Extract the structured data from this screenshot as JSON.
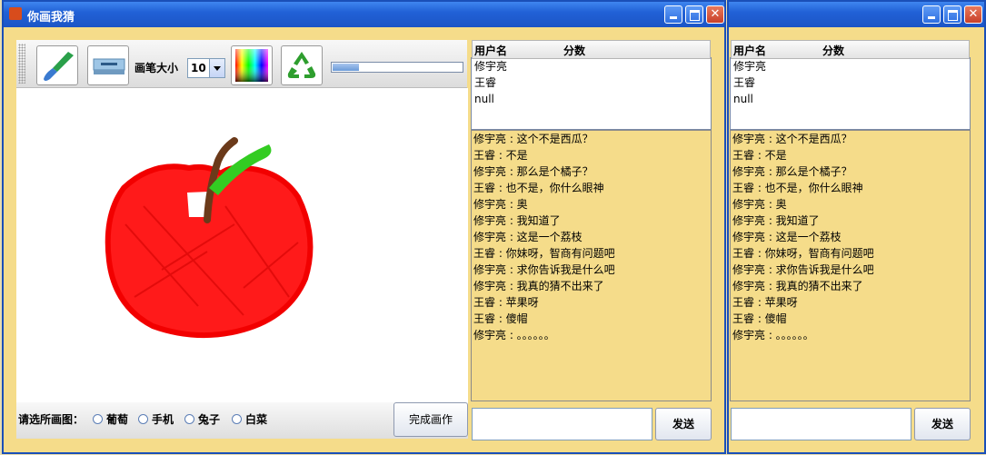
{
  "window": {
    "title": "你画我猜"
  },
  "toolbar": {
    "brush_size_label": "画笔大小",
    "brush_size_value": "10",
    "progress": 0.2
  },
  "bottom": {
    "choose_label": "请选所画图：",
    "options": [
      "葡萄",
      "手机",
      "兔子",
      "白菜"
    ],
    "finish_button": "完成画作"
  },
  "scoreboard": {
    "col_user": "用户名",
    "col_score": "分数",
    "users": [
      "修宇亮",
      "王睿",
      "null"
    ]
  },
  "chat": [
    "修宇亮 : 这个不是西瓜？",
    "王睿 : 不是",
    "修宇亮 : 那么是个橘子？",
    "王睿 : 也不是，你什么眼神",
    "修宇亮 : 奥",
    "修宇亮 : 我知道了",
    "修宇亮 : 这是一个荔枝",
    "王睿 : 你妹呀，智商有问题吧",
    "修宇亮 : 求你告诉我是什么吧",
    "修宇亮 : 我真的猜不出来了",
    "王睿 : 苹果呀",
    "王睿 : 傻帽",
    "修宇亮 : 。。。。。。"
  ],
  "send_button": "发送",
  "icons": [
    "brush-icon",
    "eraser-icon",
    "color-palette-icon",
    "recycle-icon"
  ],
  "colors": {
    "titlebar": "#2161d6",
    "apple": "#ff1a1a",
    "leaf": "#33cc22",
    "stem": "#6b3a1a"
  }
}
